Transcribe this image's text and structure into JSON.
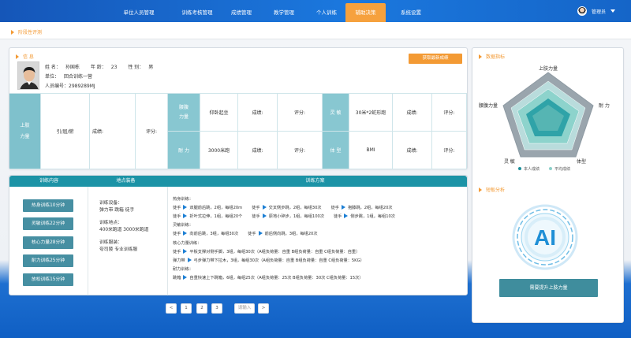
{
  "nav": {
    "items": [
      "单位人员管理",
      "训练考核管理",
      "成绩管理",
      "教学管理",
      "个人训练",
      "辅助决策",
      "系统设置"
    ],
    "active_index": 5,
    "user": "管理员"
  },
  "breadcrumb": "阶段性评测",
  "profile": {
    "section_title": "信 息",
    "button": "获取最新成绩",
    "name_label": "姓 名：",
    "name": "孙国栋",
    "age_label": "年 龄：",
    "age": "23",
    "gender_label": "性 别：",
    "gender": "男",
    "unit_label": "单位：",
    "unit": "回合训练一营",
    "id_label": "人员编号：",
    "id": "2989289MJ"
  },
  "stats": {
    "upper_strength": "上肢\n力量",
    "pull_exercise": "引/屈/俯",
    "score_label": "成绩:",
    "rating_label": "评分:",
    "core_label": "腰腹力量",
    "situp": "仰卧起坐",
    "endurance_label": "耐 力",
    "run": "3000米跑",
    "agility_label": "灵 敏",
    "shuttle": "30米*2蛇形跑",
    "body_label": "体 型",
    "bmi": "BMI"
  },
  "training": {
    "head_content": "训练内容",
    "head_place": "地点装备",
    "head_plan": "训练方案",
    "buttons": [
      "热身训练10分钟",
      "灵敏训练22分钟",
      "核心力量28分钟",
      "耐力训练25分钟",
      "放松训练15分钟"
    ],
    "equipment_label": "训练设备：",
    "equipment": "弹力带  跳箱  徒手",
    "place_label": "训练地点：",
    "place": "400米跑道 3000米跑道",
    "clothing_label": "训练服装：",
    "clothing": "夸司陵 专业训练服",
    "plan_lines": [
      {
        "text": "热身训练：",
        "arrows": []
      },
      {
        "segments": [
          "徒手",
          "双腿前后跳，2组，每组20m",
          "徒手",
          "交叉侧步跳，2组，每组30次",
          "徒手",
          "抱膝跳，2组，每组20次"
        ]
      },
      {
        "segments": [
          "徒手",
          "折叶式拉伸，1组，每组20个",
          "徒手",
          "原地小碎步，1组，每组100次",
          "徒手",
          "侧步跳，1组，每组10次"
        ]
      },
      {
        "text": "灵敏训练：",
        "arrows": []
      },
      {
        "segments": [
          "徒手",
          "向前后跳，3组，每组30次",
          "徒手",
          "前后侧向跳，3组，每组20次"
        ]
      },
      {
        "text": "核心力量训练：",
        "arrows": []
      },
      {
        "segments": [
          "徒手",
          "平板支撑对侧手脚，3组，每组30次（A组负荷量：自重 B组负荷量：自重 C组负荷量：自重）"
        ]
      },
      {
        "segments": [
          "弹力带",
          "弓步弹力带下拉木，3组，每组30次（A组负荷量：自重 B组负荷量：自重 C组负荷量：5KG）"
        ]
      },
      {
        "text": "耐力训练：",
        "arrows": []
      },
      {
        "segments": [
          "跳箱",
          "自重快速上下跳箱，6组，每组25次（A组负荷量：25次 B组负荷量：30次 C组负荷量：15次）"
        ]
      }
    ]
  },
  "pager": {
    "pages": [
      "1",
      "2",
      "3"
    ],
    "prev": "<",
    "next": ">",
    "input_placeholder": "请输入"
  },
  "right": {
    "radar_title": "数据指标",
    "axes": [
      "上肢力量",
      "耐 力",
      "体型",
      "灵 敏",
      "腰腹力量"
    ],
    "legend": [
      "本人成绩",
      "平均成绩"
    ],
    "analysis_title": "短板分析",
    "ai_text": "AI",
    "advice_button": "需要提升上肢力量",
    "colors": {
      "mine": "#1c8f9a",
      "avg": "#8ccfc8",
      "outer": "#8e9aa3"
    }
  },
  "colors": {
    "accent": "#f39a34",
    "teal": "#1c93a6",
    "nav": "#1b6fd6"
  }
}
